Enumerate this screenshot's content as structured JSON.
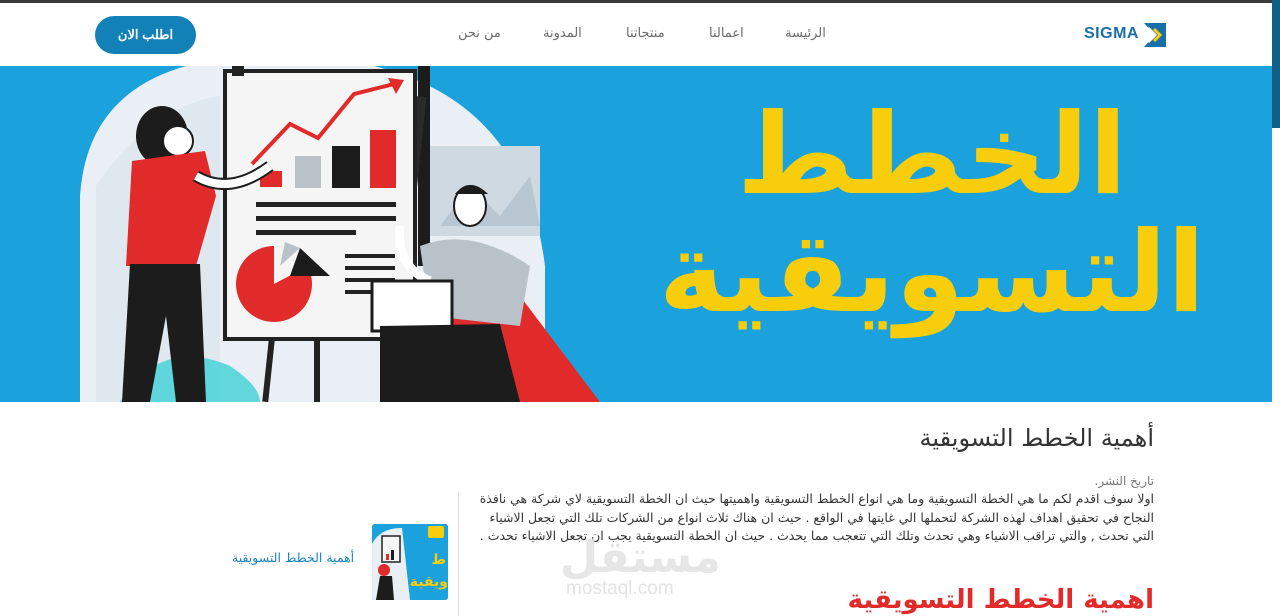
{
  "header": {
    "logo_text": "SIGMA",
    "nav": {
      "home": "الرئيسة",
      "works": "اعمالنا",
      "products": "منتجاتنا",
      "blog": "المدونة",
      "about": "من نحن"
    },
    "cta_label": "اطلب الان"
  },
  "hero": {
    "title_line1": "الخطط",
    "title_line2": "التسويقية"
  },
  "article": {
    "title": "أهمية الخطط التسويقية",
    "publish_label": "تاريخ النشر.",
    "body": "اولا سوف اقدم لكم ما هي الخطة التسويقية وما هي انواع الخطط التسويقية واهميتها حيث ان الخطة التسويقية لاي شركة هي نافذة النجاح في تحقيق اهداف لهذه الشركة لتحملها الي غايتها في الواقع . حيث ان هناك ثلاث انواع من الشركات تلك التي تجعل الاشياء التي تحدث , والتي تراقب الاشياء وهي تحدث وتلك التي تتعجب مما يحدث . حيث ان الخطة التسويقية يجب ان تجعل الاشياء تحدث .",
    "section_heading": "اهمية الخطط التسويقية"
  },
  "related": {
    "link_label": "أهمية الخطط التسويقية",
    "thumb_text": "ط\nويقية"
  },
  "watermark": {
    "arabic": "مستقل",
    "latin": "mostaql.com"
  },
  "colors": {
    "primary_blue": "#1281b7",
    "hero_blue": "#1ba2dc",
    "hero_yellow": "#f7cd0c",
    "accent_red": "#e12a2a"
  }
}
